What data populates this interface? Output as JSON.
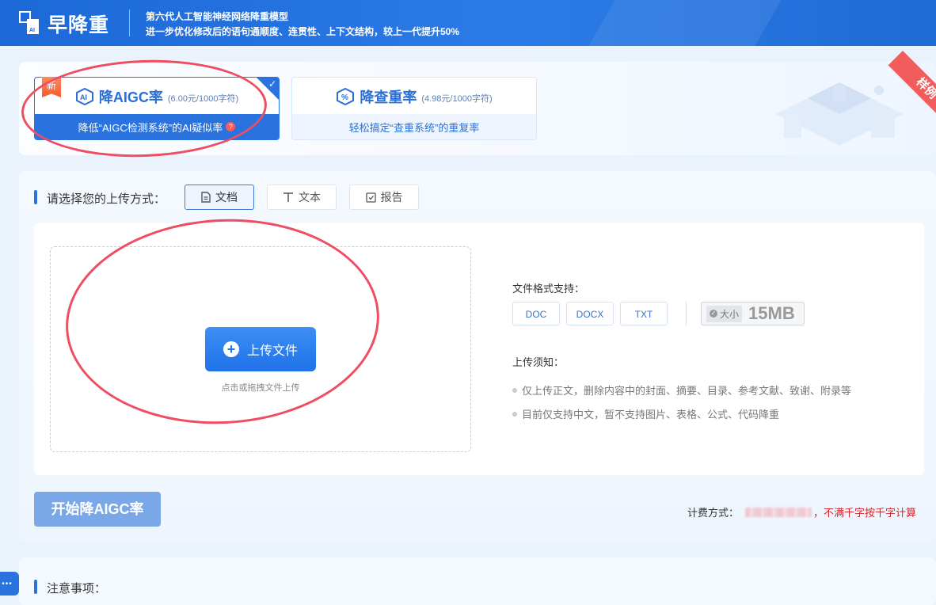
{
  "header": {
    "logo_text": "早降重",
    "tagline_line1": "第六代人工智能神经网络降重模型",
    "tagline_line2": "进一步优化修改后的语句通顺度、连贯性、上下文结构，较上一代提升50%"
  },
  "products": [
    {
      "name": "降AIGC率",
      "price": "(6.00元/1000字符)",
      "desc": "降低“AIGC检测系统”的AI疑似率",
      "badge": "新",
      "selected": true
    },
    {
      "name": "降查重率",
      "price": "(4.98元/1000字符)",
      "desc": "轻松搞定“查重系统”的重复率",
      "selected": false
    }
  ],
  "sample_ribbon": "样例",
  "upload": {
    "label": "请选择您的上传方式：",
    "modes": [
      "文档",
      "文本",
      "报告"
    ],
    "active_mode": "文档",
    "upload_button": "上传文件",
    "drop_hint": "点击或拖拽文件上传"
  },
  "formats": {
    "title": "文件格式支持：",
    "types": [
      "DOC",
      "DOCX",
      "TXT"
    ],
    "size_label": "大小",
    "size_value": "15MB"
  },
  "notes": {
    "title": "上传须知：",
    "items": [
      "仅上传正文，删除内容中的封面、摘要、目录、参考文献、致谢、附录等",
      "目前仅支持中文，暂不支持图片、表格、公式、代码降重"
    ]
  },
  "start_button": "开始降AIGC率",
  "billing": {
    "label": "计费方式：",
    "tail": "，不满千字按千字计算"
  },
  "notice_label": "注意事项：",
  "colors": {
    "primary": "#2a72de",
    "header": "#1c68d8",
    "annotation": "#ef4d63",
    "warn": "#d3262c"
  }
}
